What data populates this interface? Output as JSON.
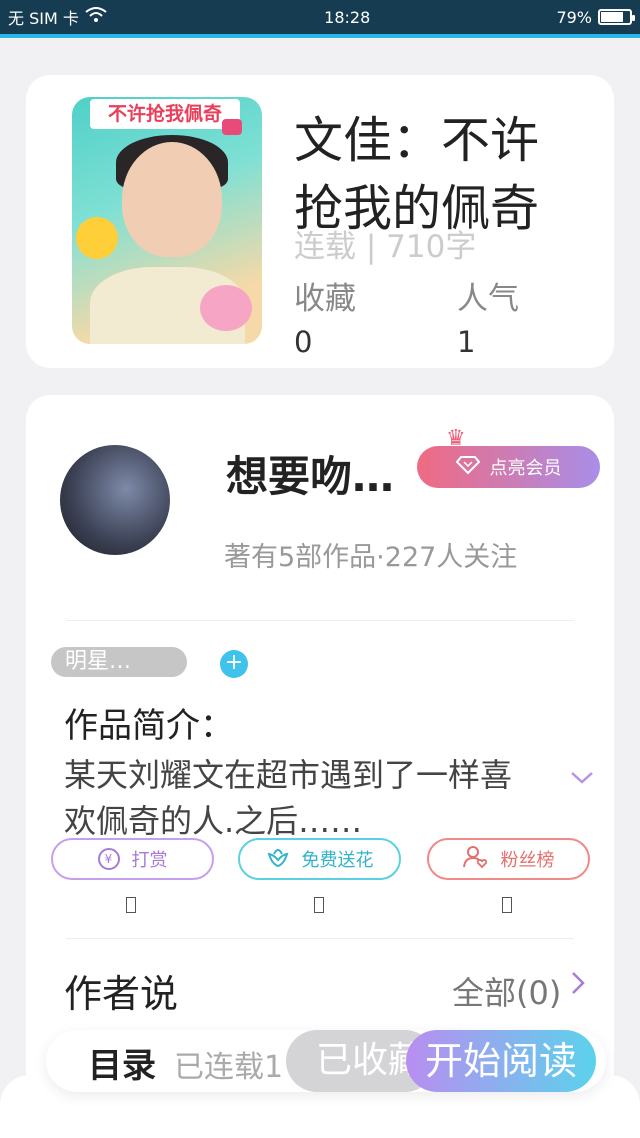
{
  "status_bar": {
    "carrier": "无 SIM 卡",
    "time": "18:28",
    "battery": "79%",
    "battery_level": 0.79
  },
  "book": {
    "cover_banner": "不许抢我佩奇",
    "title": "文佳：不许抢我的佩奇",
    "serial_info": "连载 | 710字",
    "stats": [
      {
        "label": "收藏",
        "value": "0"
      },
      {
        "label": "人气",
        "value": "1"
      }
    ]
  },
  "author": {
    "name": "想要吻…",
    "vip_button": "点亮会员",
    "meta": "著有5部作品·227人关注"
  },
  "intro": {
    "tag": "明星…",
    "tag_add": "+",
    "label": "作品简介：",
    "text": "某天刘耀文在超市遇到了一样喜欢佩奇的人.之后……"
  },
  "actions": [
    {
      "label": "打赏",
      "icon": "yen-icon"
    },
    {
      "label": "免费送花",
      "icon": "flower-icon"
    },
    {
      "label": "粉丝榜",
      "icon": "fans-icon"
    }
  ],
  "author_says": {
    "title": "作者说",
    "all_label": "全部(0)"
  },
  "bottom_bar": {
    "toc": "目录",
    "serial_status": "已连载1",
    "collected": "已收藏",
    "start_reading": "开始阅读"
  },
  "colors": {
    "accent_blue": "#29b6e8",
    "vip_gradient_start": "#f06a82",
    "vip_gradient_end": "#a88ee8"
  }
}
